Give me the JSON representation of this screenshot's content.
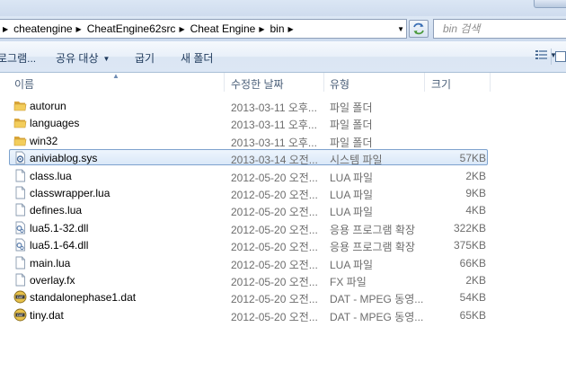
{
  "address": {
    "breadcrumbs": [
      "cheatengine",
      "CheatEngine62src",
      "Cheat Engine",
      "bin"
    ],
    "search_placeholder": "bin 검색"
  },
  "toolbar": {
    "items": [
      "로그램...",
      "공유 대상",
      "굽기",
      "새 폴더"
    ]
  },
  "columns": {
    "name": "이름",
    "date": "수정한 날짜",
    "type": "유형",
    "size": "크기"
  },
  "files": [
    {
      "name": "autorun",
      "date": "2013-03-11 오후...",
      "type": "파일 폴더",
      "size": "",
      "icon": "folder-icon"
    },
    {
      "name": "languages",
      "date": "2013-03-11 오후...",
      "type": "파일 폴더",
      "size": "",
      "icon": "folder-icon"
    },
    {
      "name": "win32",
      "date": "2013-03-11 오후...",
      "type": "파일 폴더",
      "size": "",
      "icon": "folder-icon"
    },
    {
      "name": "aniviablog.sys",
      "date": "2013-03-14 오전...",
      "type": "시스템 파일",
      "size": "57KB",
      "icon": "system-file-icon",
      "selected": true
    },
    {
      "name": "class.lua",
      "date": "2012-05-20 오전...",
      "type": "LUA 파일",
      "size": "2KB",
      "icon": "file-icon"
    },
    {
      "name": "classwrapper.lua",
      "date": "2012-05-20 오전...",
      "type": "LUA 파일",
      "size": "9KB",
      "icon": "file-icon"
    },
    {
      "name": "defines.lua",
      "date": "2012-05-20 오전...",
      "type": "LUA 파일",
      "size": "4KB",
      "icon": "file-icon"
    },
    {
      "name": "lua5.1-32.dll",
      "date": "2012-05-20 오전...",
      "type": "응용 프로그램 확장",
      "size": "322KB",
      "icon": "dll-file-icon"
    },
    {
      "name": "lua5.1-64.dll",
      "date": "2012-05-20 오전...",
      "type": "응용 프로그램 확장",
      "size": "375KB",
      "icon": "dll-file-icon"
    },
    {
      "name": "main.lua",
      "date": "2012-05-20 오전...",
      "type": "LUA 파일",
      "size": "66KB",
      "icon": "file-icon"
    },
    {
      "name": "overlay.fx",
      "date": "2012-05-20 오전...",
      "type": "FX 파일",
      "size": "2KB",
      "icon": "file-icon"
    },
    {
      "name": "standalonephase1.dat",
      "date": "2012-05-20 오전...",
      "type": "DAT - MPEG 동영...",
      "size": "54KB",
      "icon": "dat-file-icon"
    },
    {
      "name": "tiny.dat",
      "date": "2012-05-20 오전...",
      "type": "DAT - MPEG 동영...",
      "size": "65KB",
      "icon": "dat-file-icon"
    }
  ]
}
